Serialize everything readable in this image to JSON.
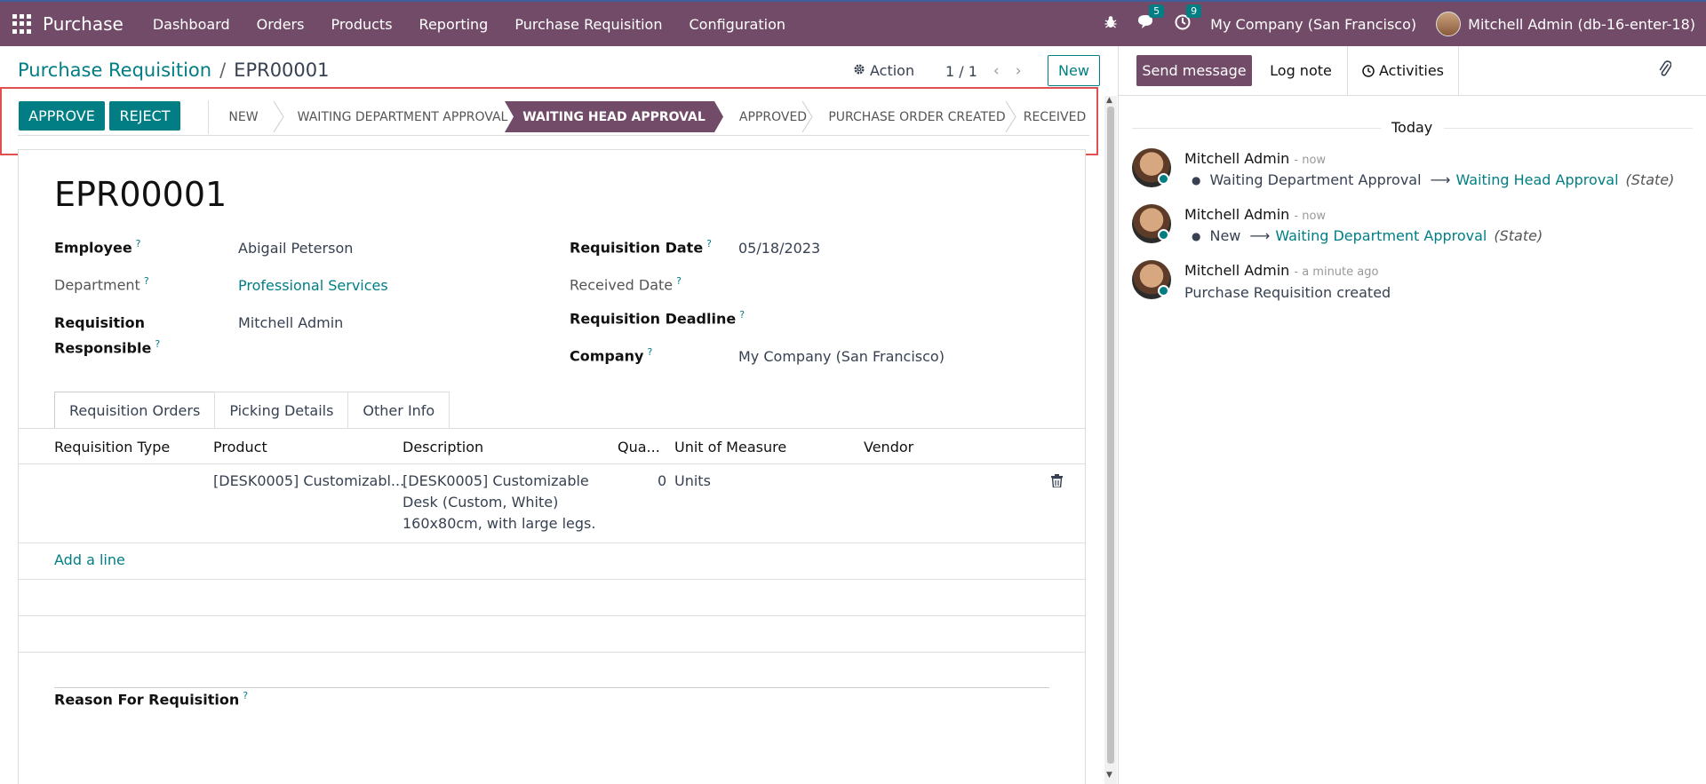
{
  "topnav": {
    "app_name": "Purchase",
    "menu": [
      "Dashboard",
      "Orders",
      "Products",
      "Reporting",
      "Purchase Requisition",
      "Configuration"
    ],
    "messages_count": "5",
    "activities_count": "9",
    "company": "My Company (San Francisco)",
    "user": "Mitchell Admin (db-16-enter-18)"
  },
  "control": {
    "breadcrumb_parent": "Purchase Requisition",
    "breadcrumb_sep": "/",
    "breadcrumb_current": "EPR00001",
    "action_label": "Action",
    "pager": "1 / 1",
    "new_label": "New"
  },
  "statusbar": {
    "approve_label": "APPROVE",
    "reject_label": "REJECT",
    "stages": [
      "NEW",
      "WAITING DEPARTMENT APPROVAL",
      "WAITING HEAD APPROVAL",
      "APPROVED",
      "PURCHASE ORDER CREATED",
      "RECEIVED"
    ],
    "active_stage": "WAITING HEAD APPROVAL"
  },
  "form": {
    "title": "EPR00001",
    "employee_label": "Employee",
    "employee_value": "Abigail Peterson",
    "department_label": "Department",
    "department_value": "Professional Services",
    "responsible_label_1": "Requisition",
    "responsible_label_2": "Responsible",
    "responsible_value": "Mitchell Admin",
    "req_date_label": "Requisition Date",
    "req_date_value": "05/18/2023",
    "received_date_label": "Received Date",
    "deadline_label": "Requisition Deadline",
    "company_label": "Company",
    "company_value": "My Company (San Francisco)",
    "help_mark": "?",
    "reason_label": "Reason For Requisition"
  },
  "tabs": [
    "Requisition Orders",
    "Picking Details",
    "Other Info"
  ],
  "table": {
    "columns": [
      "Requisition Type",
      "Product",
      "Description",
      "Qua...",
      "Unit of Measure",
      "Vendor"
    ],
    "row": {
      "type": "",
      "product": "[DESK0005] Customizabl...",
      "description_1": "[DESK0005] Customizable",
      "description_2": "Desk (Custom, White)",
      "description_3": "160x80cm, with large legs.",
      "quantity": "0",
      "uom": "Units",
      "vendor": ""
    },
    "add_line": "Add a line"
  },
  "chatter": {
    "send_message": "Send message",
    "log_note": "Log note",
    "activities": "Activities",
    "today": "Today",
    "messages": [
      {
        "author": "Mitchell Admin",
        "time": "- now",
        "old": "Waiting Department Approval",
        "new": "Waiting Head Approval",
        "field": "(State)"
      },
      {
        "author": "Mitchell Admin",
        "time": "- now",
        "old": "New",
        "new": "Waiting Department Approval",
        "field": "(State)"
      },
      {
        "author": "Mitchell Admin",
        "time": "- a minute ago",
        "body": "Purchase Requisition created"
      }
    ]
  },
  "colors": {
    "brand": "#714B67",
    "accent": "#017e84",
    "highlight": "#e05050"
  }
}
